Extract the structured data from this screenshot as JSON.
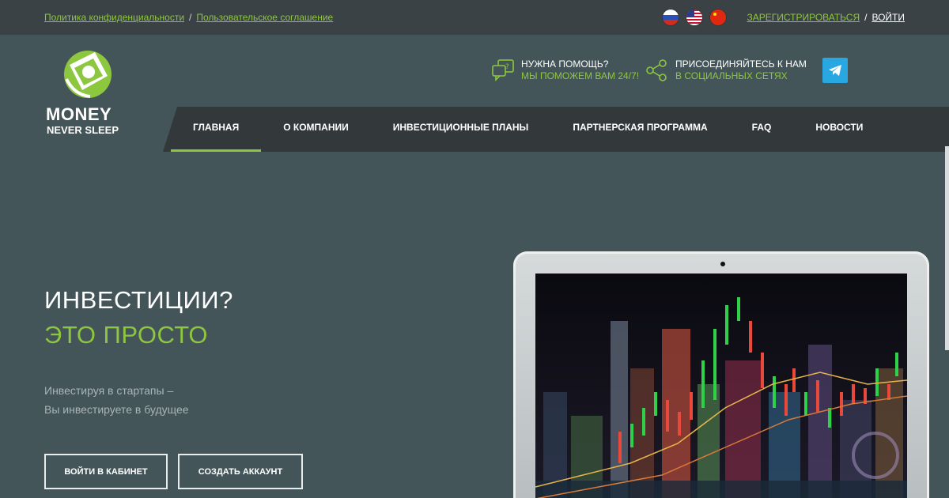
{
  "topbar": {
    "privacy_link": "Политика конфиденциальности",
    "separator": "/",
    "terms_link": "Пользовательское соглашение",
    "register_link": "ЗАРЕГИСТРИРОВАТЬСЯ",
    "login_link": "ВОЙТИ",
    "languages": [
      "ru-flag-icon",
      "us-flag-icon",
      "cn-flag-icon"
    ]
  },
  "logo": {
    "line1": "MONEY",
    "line2": "NEVER SLEEP"
  },
  "header": {
    "help_title": "НУЖНА ПОМОЩЬ?",
    "help_subtitle": "МЫ ПОМОЖЕМ ВАМ 24/7!",
    "social_title": "ПРИСОЕДИНЯЙТЕСЬ К НАМ",
    "social_subtitle": "В СОЦИАЛЬНЫХ СЕТЯХ",
    "telegram_icon": "telegram-icon"
  },
  "nav": {
    "items": [
      {
        "label": "ГЛАВНАЯ",
        "active": true
      },
      {
        "label": "О КОМПАНИИ",
        "active": false
      },
      {
        "label": "ИНВЕСТИЦИОННЫЕ ПЛАНЫ",
        "active": false
      },
      {
        "label": "ПАРТНЕРСКАЯ ПРОГРАММА",
        "active": false
      },
      {
        "label": "FAQ",
        "active": false
      },
      {
        "label": "НОВОСТИ",
        "active": false
      }
    ]
  },
  "hero": {
    "title_line1": "ИНВЕСТИЦИИ?",
    "title_line2": "ЭТО ПРОСТО",
    "subtitle_line1": "Инвестируя в стартапы –",
    "subtitle_line2": "Вы инвестируете в будущее",
    "login_button": "ВОЙТИ В КАБИНЕТ",
    "create_button": "СОЗДАТЬ АККАУНТ"
  },
  "colors": {
    "accent": "#8dc63f",
    "background": "#44555a",
    "topbar": "#3a4245",
    "nav": "#33393b",
    "telegram": "#29a7e1"
  }
}
